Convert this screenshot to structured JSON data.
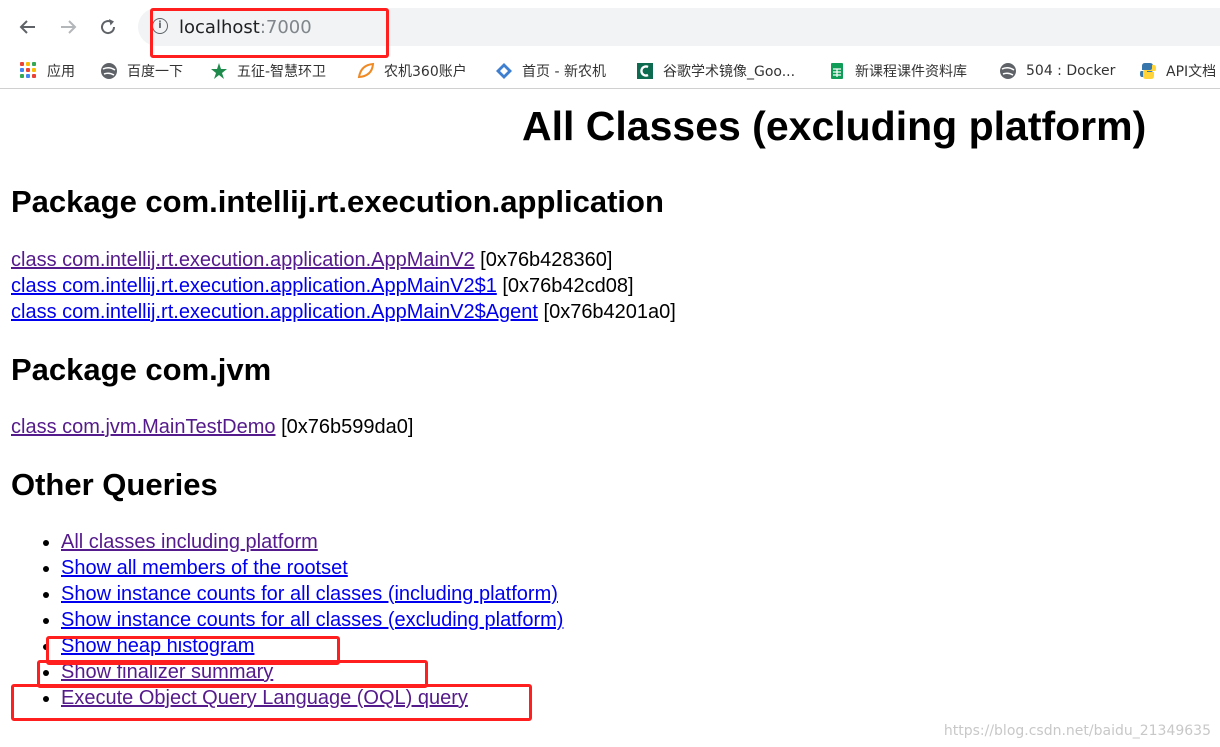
{
  "browser": {
    "url_host": "localhost",
    "url_port": ":7000",
    "bookmarks": [
      {
        "label": "应用",
        "icon": "apps-grid-icon"
      },
      {
        "label": "百度一下",
        "icon": "baidu-globe-icon"
      },
      {
        "label": "五征-智慧环卫",
        "icon": "wuzheng-logo-icon"
      },
      {
        "label": "农机360账户",
        "icon": "nongji-leaf-icon"
      },
      {
        "label": "首页 - 新农机",
        "icon": "xinnongji-diamond-icon"
      },
      {
        "label": "谷歌学术镜像_Goo...",
        "icon": "scholar-mirror-icon"
      },
      {
        "label": "新课程课件资料库",
        "icon": "spreadsheet-icon"
      },
      {
        "label": "504 : Docker",
        "icon": "docker-globe-icon"
      },
      {
        "label": "API文档",
        "icon": "python-logo-icon"
      }
    ]
  },
  "page": {
    "title": "All Classes (excluding platform)",
    "packages": [
      {
        "heading": "Package com.intellij.rt.execution.application",
        "classes": [
          {
            "link": "class com.intellij.rt.execution.application.AppMainV2",
            "address": " [0x76b428360]"
          },
          {
            "link": "class com.intellij.rt.execution.application.AppMainV2$1",
            "address": " [0x76b42cd08]"
          },
          {
            "link": "class com.intellij.rt.execution.application.AppMainV2$Agent",
            "address": " [0x76b4201a0]"
          }
        ]
      },
      {
        "heading": "Package com.jvm",
        "classes": [
          {
            "link": "class com.jvm.MainTestDemo",
            "address": " [0x76b599da0]"
          }
        ]
      }
    ],
    "other_queries": {
      "heading": "Other Queries",
      "items": [
        "All classes including platform",
        "Show all members of the rootset",
        "Show instance counts for all classes (including platform)",
        "Show instance counts for all classes (excluding platform)",
        "Show heap histogram",
        "Show finalizer summary",
        "Execute Object Query Language (OQL) query"
      ]
    }
  },
  "watermark": "https://blog.csdn.net/baidu_21349635",
  "colors": {
    "link": "#0000ee",
    "visited_link": "#551a8b",
    "annotation": "#ff1f1f"
  }
}
